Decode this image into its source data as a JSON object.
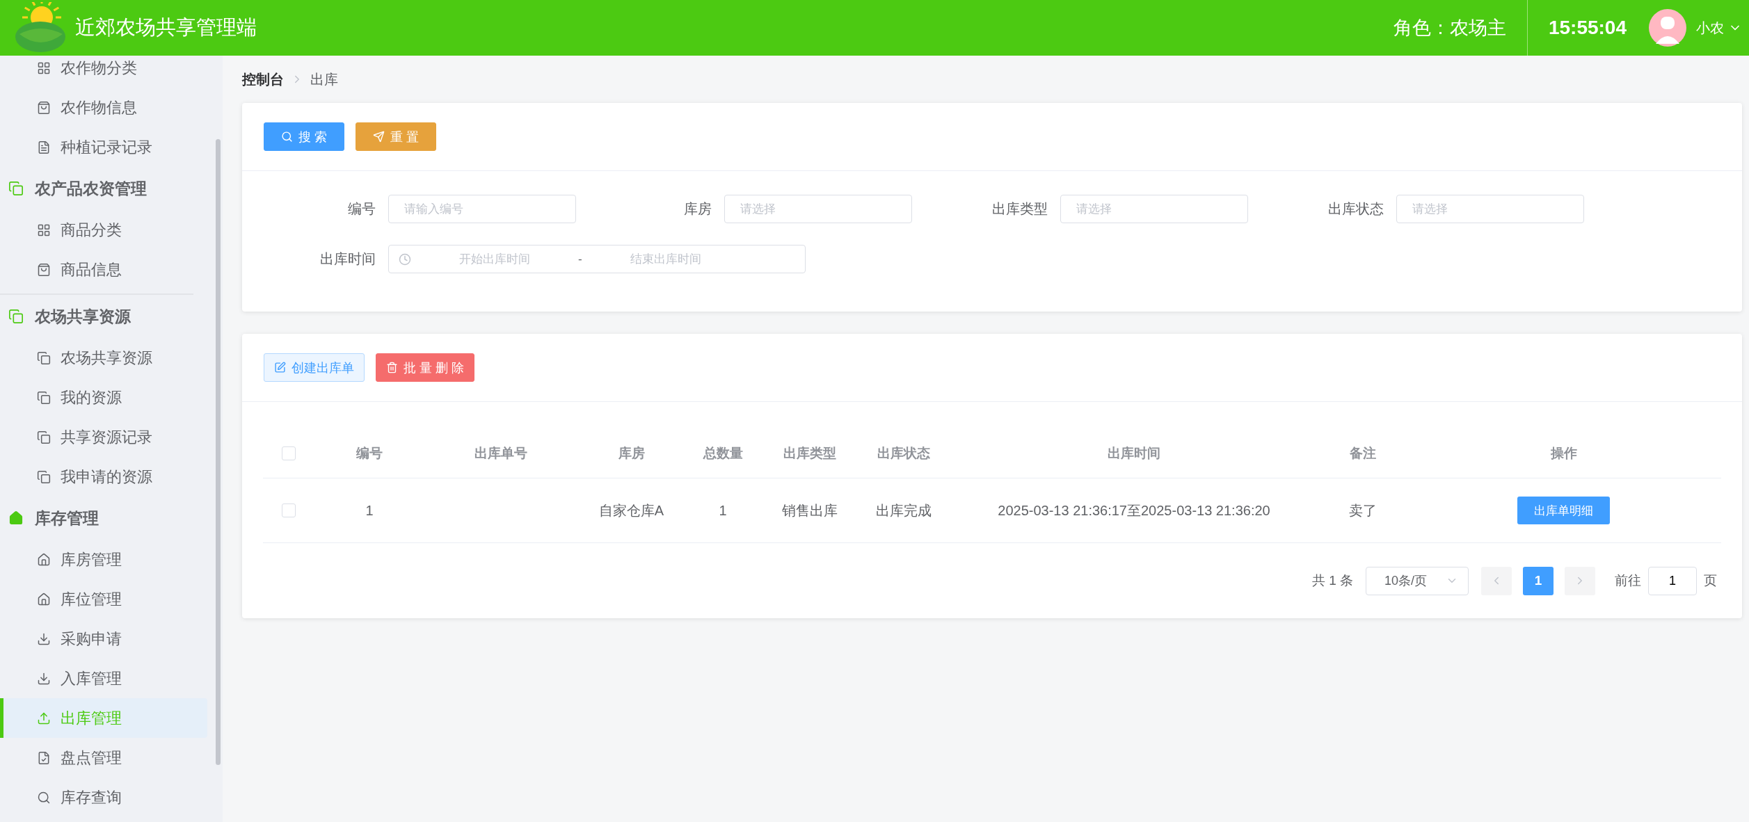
{
  "header": {
    "title": "近郊农场共享管理端",
    "role": "角色：农场主",
    "time": "15:55:04",
    "user": "小农"
  },
  "sidebar": {
    "groups": [
      {
        "items": [
          {
            "label": "农作物分类",
            "kind": "grid",
            "selected": false
          },
          {
            "label": "农作物信息",
            "kind": "bag",
            "selected": false
          },
          {
            "label": "种植记录记录",
            "kind": "doc",
            "selected": false
          }
        ]
      },
      {
        "title": "农产品农资管理",
        "kind": "copy",
        "items": [
          {
            "label": "商品分类",
            "kind": "grid",
            "selected": false
          },
          {
            "label": "商品信息",
            "kind": "bag",
            "selected": false
          }
        ]
      },
      {
        "title": "农场共享资源",
        "kind": "copy",
        "items": [
          {
            "label": "农场共享资源",
            "kind": "copy",
            "selected": false
          },
          {
            "label": "我的资源",
            "kind": "copy",
            "selected": false
          },
          {
            "label": "共享资源记录",
            "kind": "copy",
            "selected": false
          },
          {
            "label": "我申请的资源",
            "kind": "copy",
            "selected": false
          }
        ]
      },
      {
        "title": "库存管理",
        "kind": "home",
        "items": [
          {
            "label": "库房管理",
            "kind": "house",
            "selected": false
          },
          {
            "label": "库位管理",
            "kind": "house",
            "selected": false
          },
          {
            "label": "采购申请",
            "kind": "download",
            "selected": false
          },
          {
            "label": "入库管理",
            "kind": "download",
            "selected": false
          },
          {
            "label": "出库管理",
            "kind": "upload",
            "selected": true
          },
          {
            "label": "盘点管理",
            "kind": "filecheck",
            "selected": false
          },
          {
            "label": "库存查询",
            "kind": "search",
            "selected": false
          }
        ]
      }
    ]
  },
  "breadcrumb": [
    "控制台",
    "出库"
  ],
  "search_panel": {
    "buttons": [
      {
        "label": "搜 索",
        "kind": "search"
      },
      {
        "label": "重 置",
        "kind": "reset"
      }
    ],
    "fields": [
      {
        "label": "编号",
        "placeholder": "请输入编号",
        "kind": "input"
      },
      {
        "label": "库房",
        "placeholder": "请选择",
        "kind": "input"
      },
      {
        "label": "出库类型",
        "placeholder": "请选择",
        "kind": "input"
      },
      {
        "label": "出库状态",
        "placeholder": "请选择",
        "kind": "input"
      },
      {
        "label": "出库时间",
        "kind": "daterange",
        "start_placeholder": "开始出库时间",
        "separator": "-",
        "end_placeholder": "结束出库时间"
      }
    ]
  },
  "table_panel": {
    "buttons": [
      {
        "label": "创建出库单",
        "kind": "create"
      },
      {
        "label": "批 量 删 除",
        "kind": "delete"
      }
    ],
    "table": {
      "header_checked": false,
      "columns": [
        "编号",
        "出库单号",
        "库房",
        "总数量",
        "出库类型",
        "出库状态",
        "出库时间",
        "备注",
        "操作"
      ],
      "rows": [
        {
          "checked": false,
          "cells": [
            "1",
            "",
            "自家仓库A",
            "1",
            "销售出库",
            "出库完成",
            "2025-03-13 21:36:17至2025-03-13 21:36:20",
            "卖了"
          ],
          "action": "出库单明细"
        }
      ]
    },
    "pagination": {
      "total": "共 1 条",
      "page_size": "10条/页",
      "pages": [
        {
          "label": "1",
          "selected": true
        }
      ],
      "goto_label": "前往",
      "goto_value": "1",
      "page_suffix": "页"
    }
  }
}
